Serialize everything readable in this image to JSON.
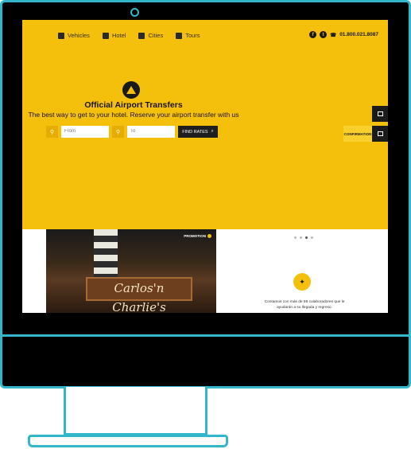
{
  "nav": {
    "items": [
      {
        "label": "Vehicles",
        "icon": "bus-icon"
      },
      {
        "label": "Hotel",
        "icon": "hotel-icon"
      },
      {
        "label": "Cities",
        "icon": "city-icon"
      },
      {
        "label": "Tours",
        "icon": "tours-icon"
      }
    ],
    "social": {
      "facebook": "f",
      "twitter": "t"
    },
    "phone": "01.800.021.8087"
  },
  "hero": {
    "title": "Official Airport Transfers",
    "subtitle": "The best way to get to your hotel. Reserve your airport transfer with us",
    "from_placeholder": "From",
    "to_placeholder": "To",
    "find_label": "FIND RATES"
  },
  "side": {
    "confirmation": "CONFIRMATION"
  },
  "promo": {
    "badge": "PROMOTION",
    "sign_text": "Carlos'n Charlie's"
  },
  "feature": {
    "text": "Contamos con más de 88 colaboradores que le ayudarán a su llegada y regreso."
  },
  "colors": {
    "accent": "#f4c00c",
    "frame": "#31b7c9",
    "dark": "#1b1b1b"
  }
}
